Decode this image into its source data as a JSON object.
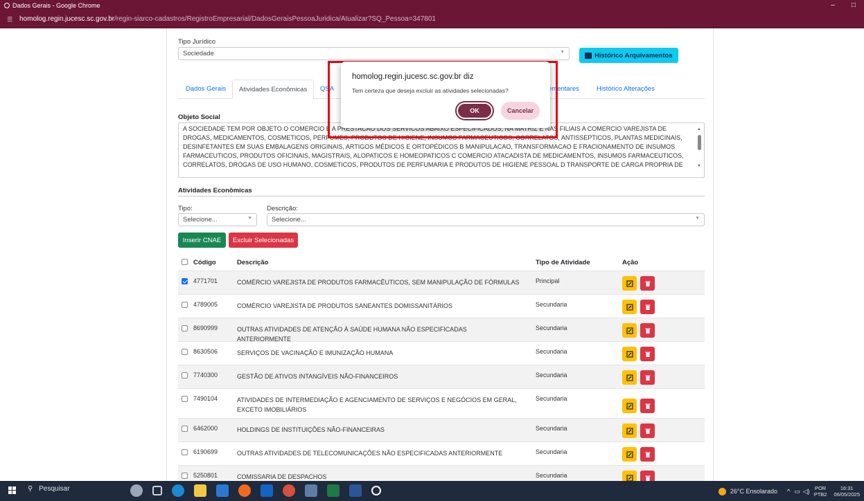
{
  "window": {
    "title": "Dados Gerais - Google Chrome",
    "url_host": "homolog.regin.jucesc.sc.gov.br",
    "url_path": "/regin-siarco-cadastros/RegistroEmpresarial/DadosGeraisPessoaJuridica/Atualizar?SQ_Pessoa=347801"
  },
  "form": {
    "tipo_juridico_label": "Tipo Jurídico",
    "tipo_juridico_value": "Sociedade",
    "historico_button": "Histórico Arquivamentos"
  },
  "tabs": [
    {
      "label": "Dados Gerais"
    },
    {
      "label": "Atividades Econômicas"
    },
    {
      "label": "QSA"
    },
    {
      "label": "...lementares"
    },
    {
      "label": "Histórico Alterações"
    }
  ],
  "objeto_social": {
    "title": "Objeto Social",
    "text": "A SOCIEDADE TEM POR OBJETO O COMERCIO E A PRESTACAO DOS SERVICOS ABAIXO ESPECIFICADOS, NA MATRIZ E NAS FILIAIS A COMERCIO VAREJISTA DE DROGAS, MEDICAMENTOS, COSMETICOS, PERFUMES, PRODUTOS DE HIGIENE, INSUMOS FARMACEUTICOS, CORRELATOS, ANTISSEPTICOS, PLANTAS MEDICINAIS, DESINFETANTES EM SUAS EMBALAGENS ORIGINAIS, ARTIGOS MÉDICOS E ORTOPÉDICOS B MANIPULACAO, TRANSFORMACAO E FRACIONAMENTO DE INSUMOS FARMACEUTICOS, PRODUTOS OFICINAIS, MAGISTRAIS, ALOPATICOS E HOMEOPATICOS C COMERCIO ATACADISTA DE MEDICAMENTOS, INSUMOS FARMACEUTICOS, CORRELATOS, DROGAS DE USO HUMANO, COSMETICOS, PRODUTOS DE PERFUMARIA E PRODUTOS DE HIGIENE PESSOAL D TRANSPORTE DE CARGA PROPRIA DE INSUMOS FARMACEUTICOS,"
  },
  "atividades": {
    "title": "Atividades Econômicas",
    "tipo_label": "Tipo:",
    "tipo_value": "Selecione...",
    "descricao_label": "Descrição:",
    "descricao_value": "Selecione...",
    "insert_button": "Inserir CNAE",
    "delete_button": "Excluir Selecionadas",
    "headers": {
      "codigo": "Código",
      "descricao": "Descrição",
      "tipo": "Tipo de Atividade",
      "acao": "Ação"
    },
    "rows": [
      {
        "codigo": "4771701",
        "descricao": "COMÉRCIO VAREJISTA DE PRODUTOS FARMACÊUTICOS, SEM MANIPULAÇÃO DE FÓRMULAS",
        "tipo": "Principal",
        "checked": true
      },
      {
        "codigo": "4789005",
        "descricao": "COMÉRCIO VAREJISTA DE PRODUTOS SANEANTES DOMISSANITÁRIOS",
        "tipo": "Secundaria",
        "checked": false
      },
      {
        "codigo": "8690999",
        "descricao": "OUTRAS ATIVIDADES DE ATENÇÃO À SAÚDE HUMANA NÃO ESPECIFICADAS ANTERIORMENTE",
        "tipo": "Secundaria",
        "checked": false
      },
      {
        "codigo": "8630506",
        "descricao": "SERVIÇOS DE VACINAÇÃO E IMUNIZAÇÃO HUMANA",
        "tipo": "Secundaria",
        "checked": false
      },
      {
        "codigo": "7740300",
        "descricao": "GESTÃO DE ATIVOS INTANGÍVEIS NÃO-FINANCEIROS",
        "tipo": "Secundaria",
        "checked": false
      },
      {
        "codigo": "7490104",
        "descricao": "ATIVIDADES DE INTERMEDIAÇÃO E AGENCIAMENTO DE SERVIÇOS E NEGÓCIOS EM GERAL, EXCETO IMOBILIÁRIOS",
        "tipo": "Secundaria",
        "checked": false
      },
      {
        "codigo": "6462000",
        "descricao": "HOLDINGS DE INSTITUIÇÕES NÃO-FINANCEIRAS",
        "tipo": "Secundaria",
        "checked": false
      },
      {
        "codigo": "6190699",
        "descricao": "OUTRAS ATIVIDADES DE TELECOMUNICAÇÕES NÃO ESPECIFICADAS ANTERIORMENTE",
        "tipo": "Secundaria",
        "checked": false
      },
      {
        "codigo": "5250801",
        "descricao": "COMISSARIA DE DESPACHOS",
        "tipo": "Secundaria",
        "checked": false
      }
    ]
  },
  "dialog": {
    "title": "homolog.regin.jucesc.sc.gov.br diz",
    "message": "Tem certeza que deseja excluir as atividades selecionadas?",
    "ok": "OK",
    "cancel": "Cancelar"
  },
  "taskbar": {
    "search": "Pesquisar",
    "weather": "26°C Ensolarado",
    "lang": "POR",
    "lang_sub": "PTB2",
    "time": "16:31",
    "date": "06/05/2025"
  },
  "colors": {
    "chrome": "#6b1634",
    "primary": "#0d6efd",
    "success": "#198754",
    "danger": "#dc3545",
    "warning": "#ffc107",
    "info": "#0dcaf0"
  }
}
